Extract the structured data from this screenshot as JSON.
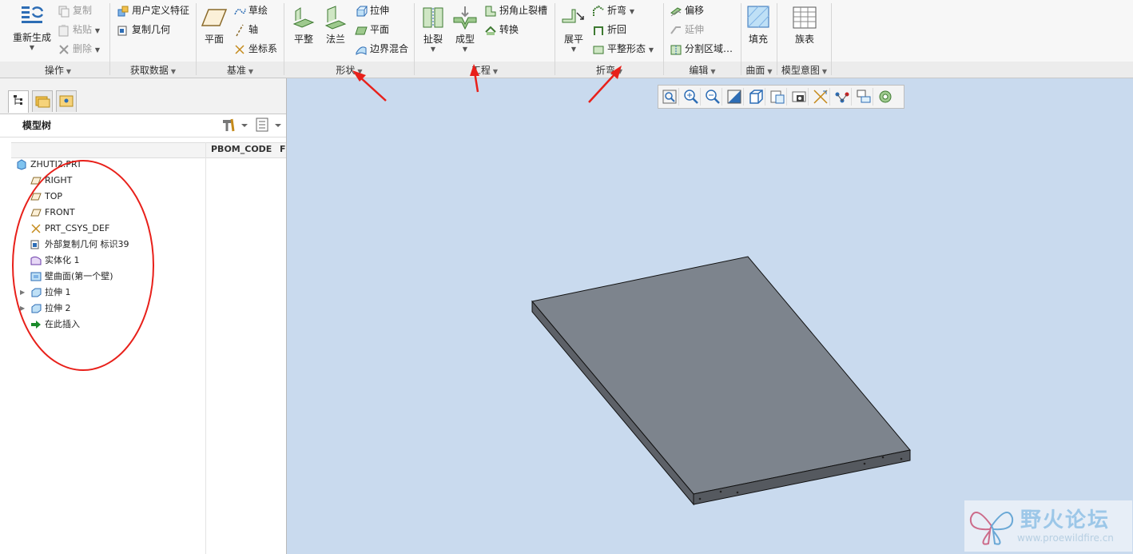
{
  "ribbon": {
    "operations": {
      "regenerate": "重新生成",
      "copy": "复制",
      "paste": "粘贴",
      "delete": "删除",
      "group_label": "操作"
    },
    "get_data": {
      "udf": "用户定义特征",
      "copy_geom": "复制几何",
      "group_label": "获取数据"
    },
    "datum": {
      "plane": "平面",
      "sketch": "草绘",
      "axis": "轴",
      "csys": "坐标系",
      "group_label": "基准"
    },
    "shapes": {
      "planar": "平整",
      "flange": "法兰",
      "extrude": "拉伸",
      "flat": "平面",
      "boundary_blend": "边界混合",
      "group_label": "形状"
    },
    "engineering": {
      "rip": "扯裂",
      "form": "成型",
      "corner_relief": "拐角止裂槽",
      "convert": "转换",
      "group_label": "工程"
    },
    "bends": {
      "unbend": "展平",
      "bend": "折弯",
      "bend_back": "折回",
      "flat_state": "平整形态",
      "group_label": "折弯"
    },
    "editing": {
      "offset": "偏移",
      "extend": "延伸",
      "split_area": "分割区域…",
      "group_label": "编辑"
    },
    "surfaces": {
      "fill": "填充",
      "group_label": "曲面"
    },
    "model_intent": {
      "family_table": "族表",
      "group_label": "模型意图"
    }
  },
  "model_tree": {
    "title": "模型树",
    "column_header": "PBOM_CODE",
    "column_header_2": "F",
    "items": [
      {
        "label": "ZHUTI2.PRT",
        "icon": "part-icon"
      },
      {
        "label": "RIGHT",
        "icon": "datum-plane-icon"
      },
      {
        "label": "TOP",
        "icon": "datum-plane-icon"
      },
      {
        "label": "FRONT",
        "icon": "datum-plane-icon"
      },
      {
        "label": "PRT_CSYS_DEF",
        "icon": "csys-icon"
      },
      {
        "label": "外部复制几何 标识39",
        "icon": "copy-geometry-icon"
      },
      {
        "label": "实体化 1",
        "icon": "solidify-icon"
      },
      {
        "label": "壁曲面(第一个壁)",
        "icon": "wall-surface-icon"
      },
      {
        "label": "拉伸 1",
        "icon": "extrude-icon"
      },
      {
        "label": "拉伸 2",
        "icon": "extrude-icon"
      },
      {
        "label": "在此插入",
        "icon": "insert-here-icon"
      }
    ]
  },
  "watermark": {
    "title": "野火论坛",
    "url": "www.proewildfire.cn"
  },
  "colors": {
    "graphics_bg": "#c9daee",
    "annotation_red": "#e8201a",
    "plate_top": "#7d848d"
  }
}
